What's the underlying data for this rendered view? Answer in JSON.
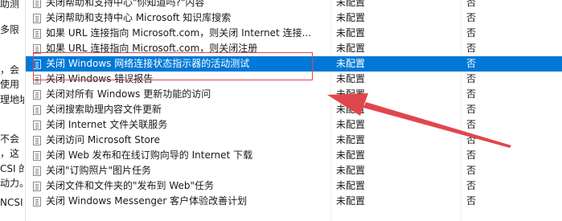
{
  "left_pane_fragments": [
    {
      "id": "frag-1",
      "text": "助测"
    },
    {
      "id": "frag-2",
      "text": "多限"
    },
    {
      "id": "frag-3",
      "text": "，会"
    },
    {
      "id": "frag-4",
      "text": "使用"
    },
    {
      "id": "frag-5",
      "text": "理地址"
    },
    {
      "id": "frag-6",
      "text": "不会"
    },
    {
      "id": "frag-7",
      "text": "，这"
    },
    {
      "id": "frag-8",
      "text": "CSI 的"
    },
    {
      "id": "frag-9",
      "text": "动力。"
    },
    {
      "id": "frag-10",
      "text": "NCSI"
    }
  ],
  "policy_list": {
    "rows": [
      {
        "name": "关闭帮助和支持中心\"你知道吗?\"内容",
        "state": "未配置",
        "comment": "否",
        "selected": false
      },
      {
        "name": "关闭帮助和支持中心 Microsoft 知识库搜索",
        "state": "未配置",
        "comment": "否",
        "selected": false
      },
      {
        "name": "如果 URL 连接指向 Microsoft.com，则关闭 Internet 连接...",
        "state": "未配置",
        "comment": "否",
        "selected": false
      },
      {
        "name": "如果 URL 连接指向 Microsoft.com，则关闭注册",
        "state": "未配置",
        "comment": "否",
        "selected": false
      },
      {
        "name": "关闭 Windows 网络连接状态指示器的活动测试",
        "state": "未配置",
        "comment": "否",
        "selected": true
      },
      {
        "name": "关闭 Windows 错误报告",
        "state": "未配置",
        "comment": "否",
        "selected": false
      },
      {
        "name": "关闭对所有 Windows 更新功能的访问",
        "state": "未配置",
        "comment": "否",
        "selected": false
      },
      {
        "name": "关闭搜索助理内容文件更新",
        "state": "未配置",
        "comment": "否",
        "selected": false
      },
      {
        "name": "关闭 Internet 文件关联服务",
        "state": "未配置",
        "comment": "否",
        "selected": false
      },
      {
        "name": "关闭访问 Microsoft Store",
        "state": "未配置",
        "comment": "否",
        "selected": false
      },
      {
        "name": "关闭 Web 发布和在线订购向导的 Internet 下载",
        "state": "未配置",
        "comment": "否",
        "selected": false
      },
      {
        "name": "关闭\"订购照片\"图片任务",
        "state": "未配置",
        "comment": "否",
        "selected": false
      },
      {
        "name": "关闭文件和文件夹的\"发布到 Web\"任务",
        "state": "未配置",
        "comment": "否",
        "selected": false
      },
      {
        "name": "关闭 Windows Messenger 客户体验改善计划",
        "state": "未配置",
        "comment": "否",
        "selected": false
      }
    ]
  },
  "colors": {
    "selection": "#0078d7",
    "annotation": "#e0474c"
  }
}
